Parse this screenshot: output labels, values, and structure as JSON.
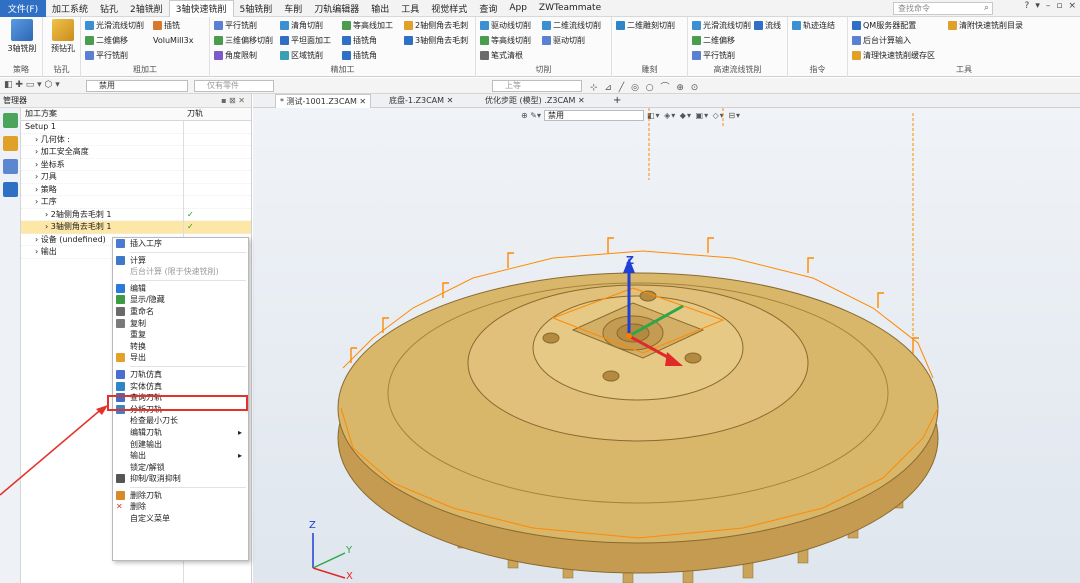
{
  "menu": {
    "file": "文件(F)",
    "items": [
      "加工系统",
      "钻孔",
      "2轴铣削",
      "3轴快速铣削",
      "5轴铣削",
      "车削",
      "刀轨编辑器",
      "输出",
      "工具",
      "视觉样式",
      "查询",
      "App",
      "ZWTeammate"
    ],
    "active_index": 3
  },
  "search": {
    "placeholder": "查找命令"
  },
  "window_controls": [
    "?",
    "▾",
    "–",
    "▫",
    "×"
  ],
  "ribbon": {
    "groups": [
      {
        "label": "策略",
        "buttons": [
          "3轴铣削"
        ]
      },
      {
        "label": "钻孔",
        "buttons": [
          "预钻孔"
        ]
      },
      {
        "label": "粗加工",
        "buttons": [
          "光滑流线切削",
          "二维偏移",
          "平行铣削",
          "插铣",
          "VoluMill3x"
        ]
      },
      {
        "label": "精加工",
        "buttons": [
          "平行铣削",
          "三维偏移切削",
          "角度限制",
          "清角切削",
          "平坦面加工",
          "区域铣削",
          "等高线加工",
          "插铣角",
          "插铣角",
          "2轴侧角去毛刺",
          "3轴侧角去毛刺"
        ]
      },
      {
        "label": "切削",
        "buttons": [
          "驱动线切削",
          "等高线切削",
          "笔式清根",
          "二维流线切削",
          "驱动切削"
        ]
      },
      {
        "label": "雕刻",
        "buttons": [
          "二维雕刻切削"
        ]
      },
      {
        "label": "高速流线铣削",
        "buttons": [
          "光滑流线切削",
          "二维偏移",
          "平行铣削",
          "流线"
        ]
      },
      {
        "label": "指令",
        "buttons": [
          "轨迹连结"
        ]
      },
      {
        "label": "工具",
        "buttons": [
          "QM服务器配置",
          "后台计算输入",
          "清理快速铣削缓存区",
          "清附快速铣削目录"
        ]
      }
    ]
  },
  "quickbar": {
    "filter_value": "禁用",
    "part_filter": "仅有零件",
    "plane": "上等"
  },
  "panel": {
    "title": "管理器",
    "col1": "加工方案",
    "col2": "刀轨",
    "rows": [
      {
        "label": "Setup 1",
        "indent": 0
      },
      {
        "label": "几何体 :",
        "indent": 1
      },
      {
        "label": "加工安全高度",
        "indent": 1
      },
      {
        "label": "坐标系",
        "indent": 1
      },
      {
        "label": "刀具",
        "indent": 1
      },
      {
        "label": "策略",
        "indent": 1
      },
      {
        "label": "工序",
        "indent": 1
      },
      {
        "label": "2轴侧角去毛刺 1",
        "indent": 2,
        "check": "✓"
      },
      {
        "label": "3轴侧角去毛刺 1",
        "indent": 2,
        "check": "✓",
        "selected": true
      },
      {
        "label": "设备 (undefined)",
        "indent": 1
      },
      {
        "label": "输出",
        "indent": 1
      }
    ]
  },
  "context_menu": [
    {
      "label": "插入工序",
      "icon": "#4a7bd0"
    },
    {
      "sep": true
    },
    {
      "label": "计算",
      "icon": "#3e78c8"
    },
    {
      "label": "后台计算 (限于快速铣削)",
      "disabled": true
    },
    {
      "sep": true
    },
    {
      "label": "编辑",
      "icon": "#2b7ad8"
    },
    {
      "label": "显示/隐藏",
      "icon": "#3c9c45"
    },
    {
      "label": "重命名",
      "icon": "#6a6a6a"
    },
    {
      "label": "复制",
      "icon": "#7a7a7a"
    },
    {
      "label": "重复"
    },
    {
      "label": "转换"
    },
    {
      "label": "导出",
      "icon": "#e3a12b"
    },
    {
      "sep": true
    },
    {
      "label": "刀轨仿真",
      "icon": "#4b6fd1"
    },
    {
      "label": "实体仿真",
      "icon": "#2f86c6",
      "highlight": true
    },
    {
      "label": "查询刀轨",
      "icon": "#3c70c5"
    },
    {
      "label": "分析刀轨",
      "icon": "#3d82c9"
    },
    {
      "label": "检查最小刀长"
    },
    {
      "label": "编辑刀轨",
      "arrow": "▸"
    },
    {
      "label": "创建输出"
    },
    {
      "label": "输出",
      "arrow": "▸"
    },
    {
      "label": "锁定/解锁"
    },
    {
      "label": "抑制/取消抑制",
      "icon": "#555"
    },
    {
      "sep": true
    },
    {
      "label": "删除刀轨",
      "icon": "#d68a2a"
    },
    {
      "label": "删除",
      "icon": "#e0352e",
      "mark": "✕"
    },
    {
      "label": "自定义菜单"
    }
  ],
  "tabs": [
    {
      "label": "* 测试-1001.Z3CAM",
      "active": true
    },
    {
      "label": "底盘-1.Z3CAM"
    },
    {
      "label": "优化步距 (模型) .Z3CAM"
    }
  ],
  "view_filter": "禁用",
  "axes": {
    "z": "Z",
    "y": "Y",
    "x": "X"
  },
  "colors": {
    "accent": "#2f6fc4",
    "toolpath": "#ff8a00",
    "part": "#d8b66a",
    "highlight": "#e5312b"
  }
}
